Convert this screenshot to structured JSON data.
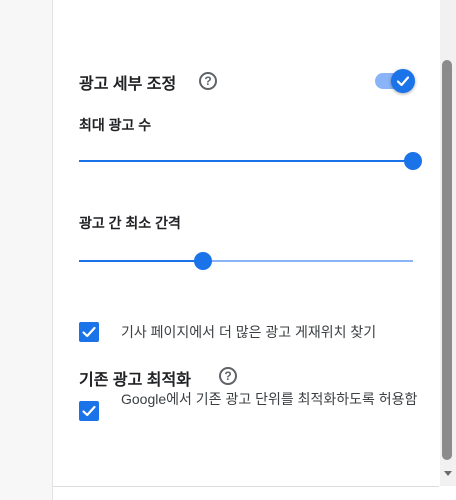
{
  "ad_settings": {
    "title": "광고 세부 조정",
    "toggle_on": true,
    "max_ads_label": "최대 광고 수",
    "max_ads_level": 1.0,
    "min_spacing_label": "광고 간 최소 간격",
    "min_spacing_level": 0.37,
    "find_placements_label": "기사 페이지에서 더 많은 광고 게재위치 찾기",
    "find_placements_checked": true
  },
  "existing_ads": {
    "title": "기존 광고 최적화",
    "optimize_label": "Google에서 기존 광고 단위를 최적화하도록 허용함",
    "optimize_checked": true
  },
  "colors": {
    "accent": "#1a73e8",
    "accent_light": "#8ab4f8"
  }
}
